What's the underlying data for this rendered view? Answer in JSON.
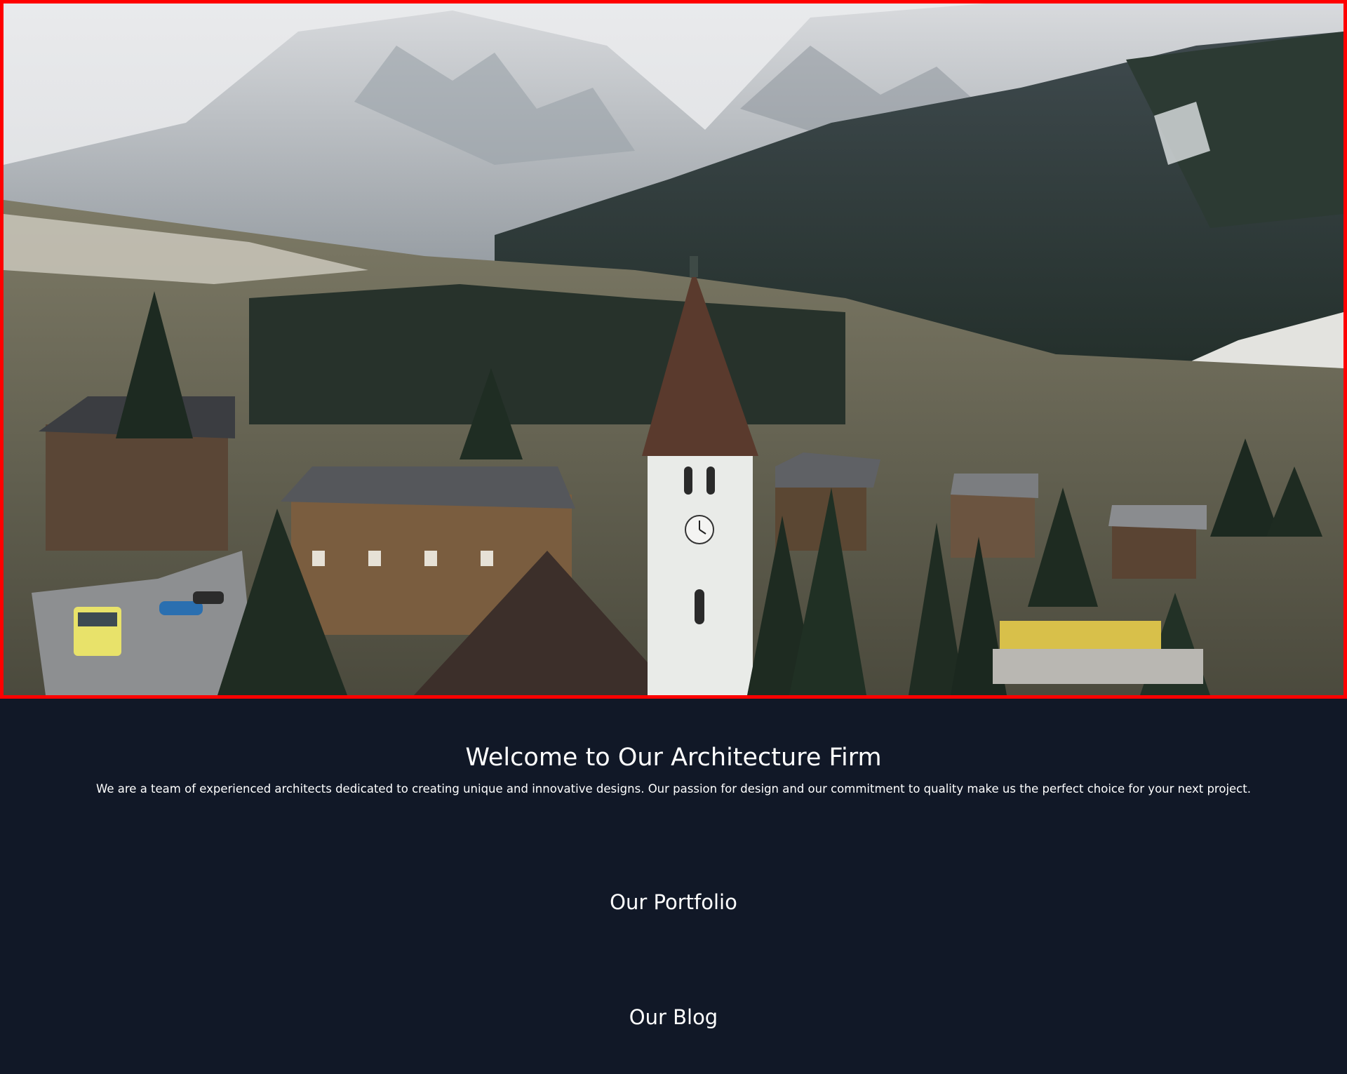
{
  "hero": {
    "image_alt": "Snowy alpine village with church tower and forested mountains",
    "accent_border_color": "#ff0000"
  },
  "intro": {
    "title": "Welcome to Our Architecture Firm",
    "description": "We are a team of experienced architects dedicated to creating unique and innovative designs. Our passion for design and our commitment to quality make us the perfect choice for your next project."
  },
  "sections": {
    "portfolio_title": "Our Portfolio",
    "blog_title": "Our Blog"
  },
  "theme": {
    "background": "#111827",
    "text": "#ffffff"
  }
}
